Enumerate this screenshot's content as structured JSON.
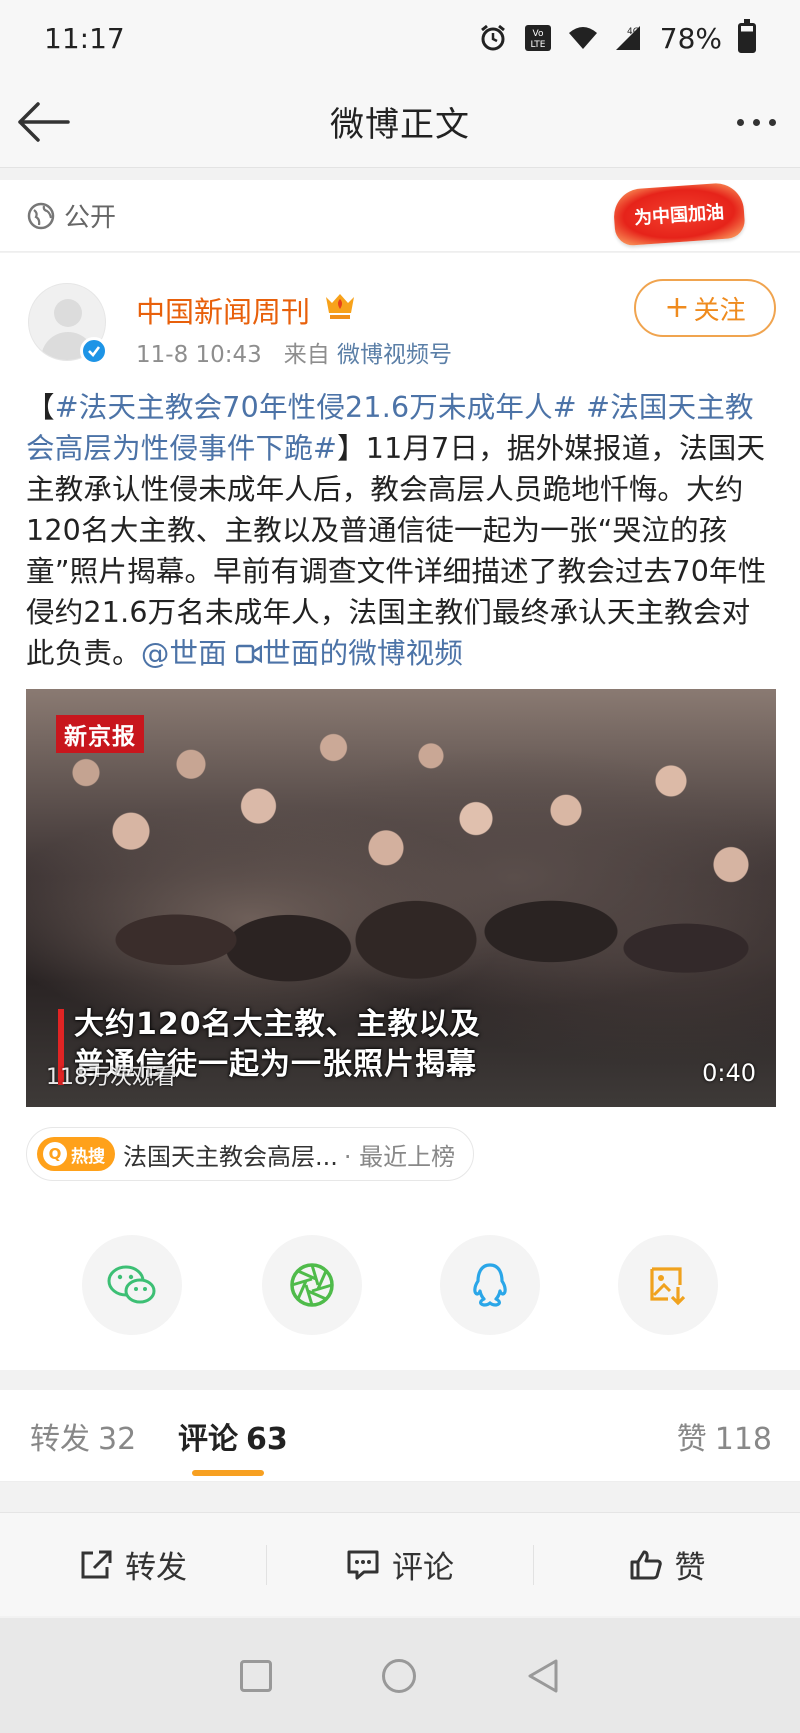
{
  "status_bar": {
    "time": "11:17",
    "network": "4G",
    "volte": "Vo LTE",
    "battery": "78%"
  },
  "header": {
    "title": "微博正文"
  },
  "visibility": {
    "label": "公开",
    "badge_text": "为中国加油"
  },
  "post": {
    "author": "中国新闻周刊",
    "date": "11-8 10:43",
    "source_prefix": "来自",
    "source": "微博视频号",
    "follow_label": "关注",
    "text": {
      "open_bracket": "【",
      "hashtag1": "#法天主教会70年性侵21.6万未成年人#",
      "hashtag2": "#法国天主教会高层为性侵事件下跪#",
      "body": "】11月7日，据外媒报道，法国天主教承认性侵未成年人后，教会高层人员跪地忏悔。大约120名大主教、主教以及普通信徒一起为一张“哭泣的孩童”照片揭幕。早前有调查文件详细描述了教会过去70年性侵约21.6万名未成年人，法国主教们最终承认天主教会对此负责。",
      "mention": "@世面",
      "video_link": "世面的微博视频"
    },
    "video": {
      "logo": "新京报",
      "caption_line1": "大约120名大主教、主教以及",
      "caption_line2": "普通信徒一起为一张照片揭幕",
      "views": "118万次观看",
      "duration": "0:40"
    },
    "hot_search": {
      "badge": "热搜",
      "text": "法国天主教会高层...",
      "suffix": "· 最近上榜"
    },
    "share_targets": [
      "wechat-icon",
      "moments-icon",
      "qq-icon",
      "save-image-icon"
    ]
  },
  "tabs": {
    "repost": {
      "label": "转发",
      "count": "32"
    },
    "comments": {
      "label": "评论",
      "count": "63"
    },
    "likes": {
      "label": "赞",
      "count": "118"
    }
  },
  "actions": {
    "repost": "转发",
    "comment": "评论",
    "like": "赞"
  },
  "colors": {
    "accent_orange": "#ef8b1e",
    "link_blue": "#4c73a7",
    "verified_blue": "#1d94e6",
    "tab_underline": "#f7a021"
  }
}
